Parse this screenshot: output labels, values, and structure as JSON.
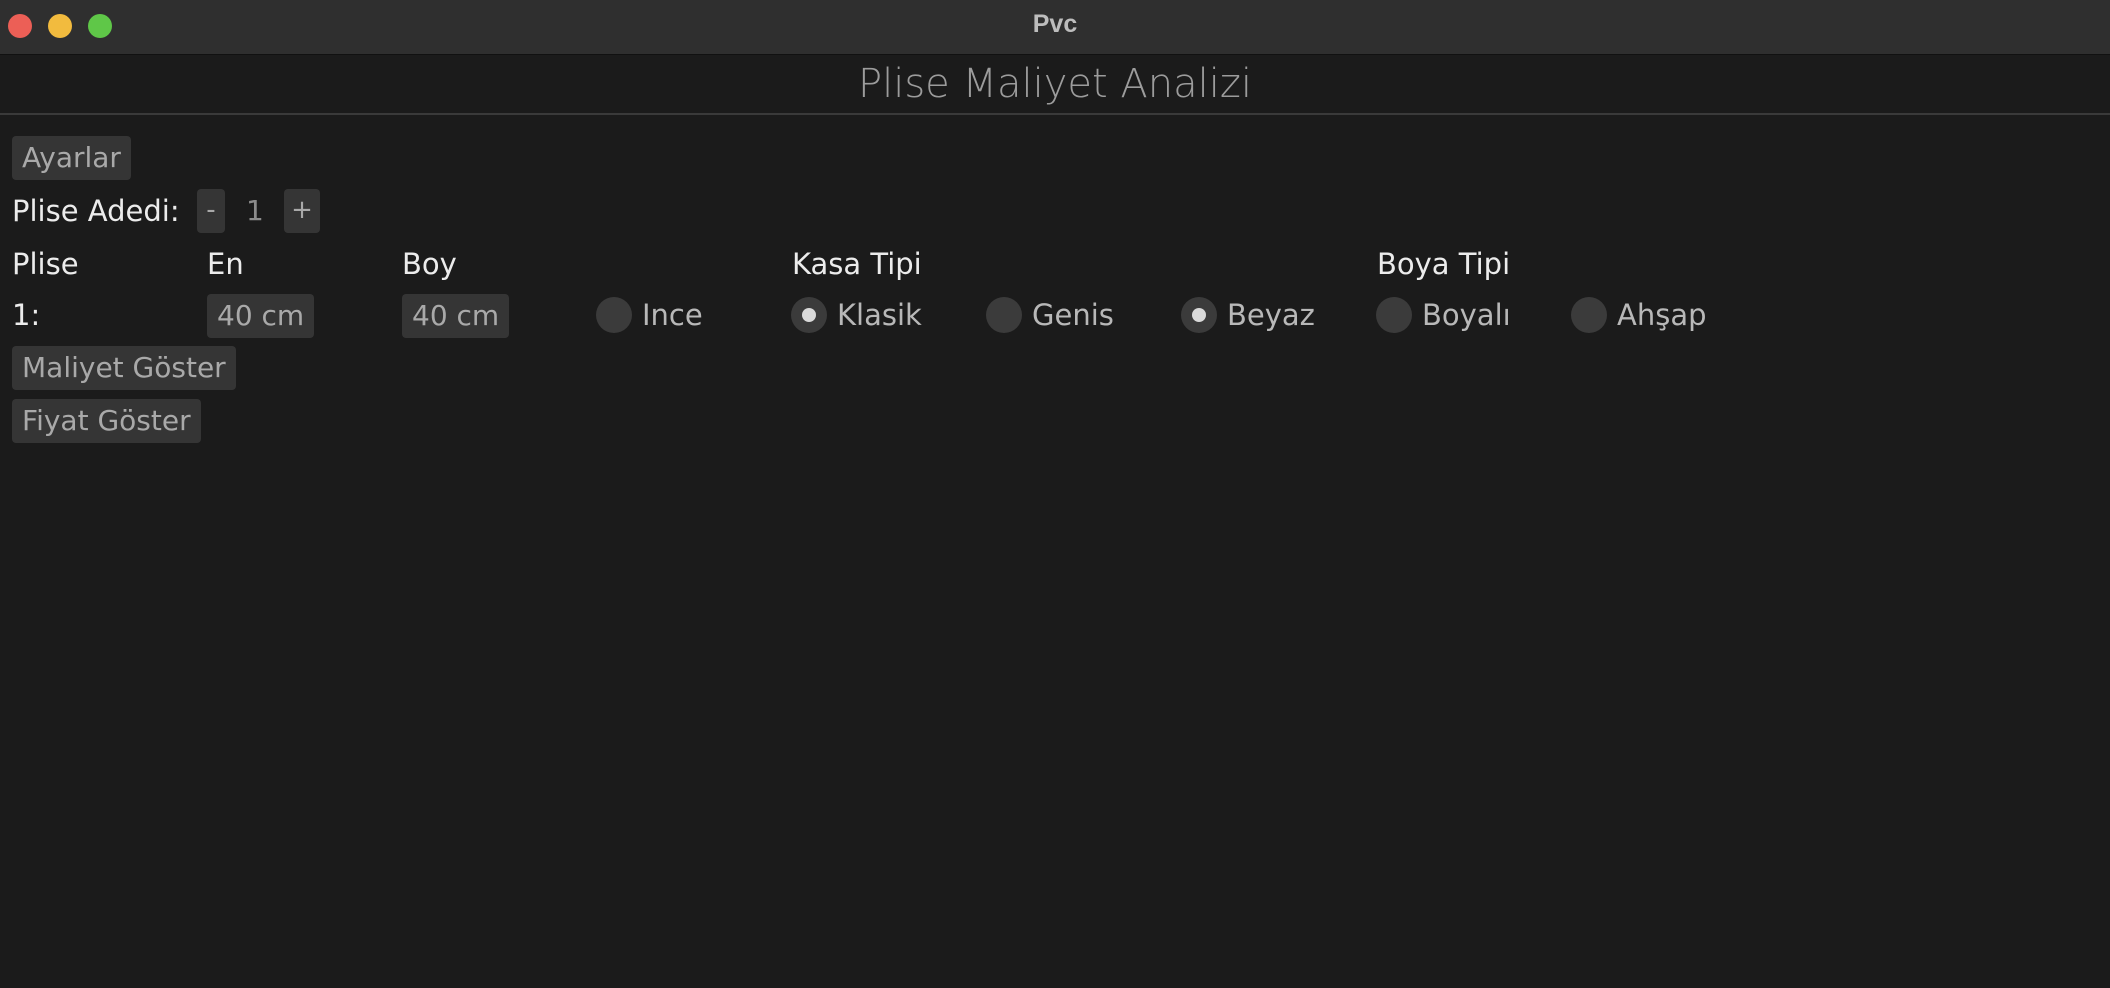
{
  "window": {
    "title": "Pvc"
  },
  "app": {
    "title": "Plise Maliyet Analizi"
  },
  "buttons": {
    "settings": "Ayarlar",
    "show_cost": "Maliyet Göster",
    "show_price": "Fiyat Göster"
  },
  "quantity": {
    "label": "Plise Adedi:",
    "minus": "-",
    "value": "1",
    "plus": "+"
  },
  "columns": {
    "plise": "Plise",
    "en": "En",
    "boy": "Boy",
    "kasa_tipi": "Kasa Tipi",
    "boya_tipi": "Boya Tipi"
  },
  "rows": [
    {
      "index": "1:",
      "en": "40 cm",
      "boy": "40 cm",
      "options": [
        {
          "label": "Ince",
          "checked": false
        },
        {
          "label": "Klasik",
          "checked": true
        },
        {
          "label": "Genis",
          "checked": false
        },
        {
          "label": "Beyaz",
          "checked": true
        },
        {
          "label": "Boyalı",
          "checked": false
        },
        {
          "label": "Ahşap",
          "checked": false
        }
      ]
    }
  ]
}
